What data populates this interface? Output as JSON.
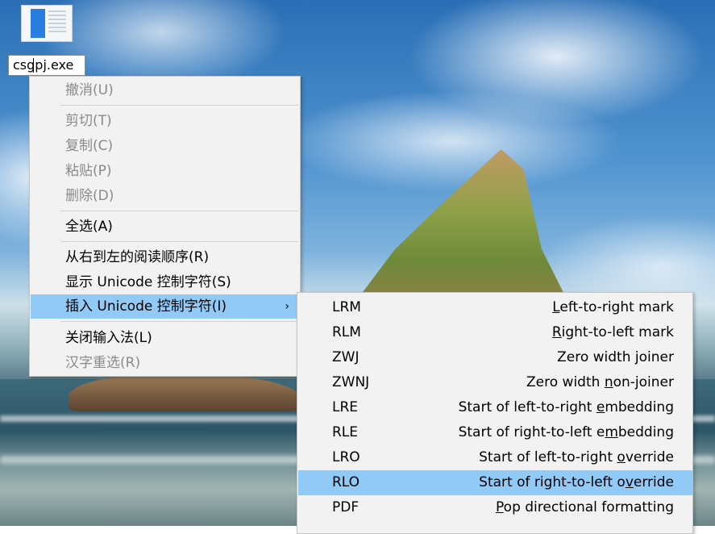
{
  "desktop": {
    "file_name": "csgpj.exe"
  },
  "context_menu": {
    "items": [
      {
        "label": "撤消(U)",
        "enabled": false
      },
      {
        "label": "剪切(T)",
        "enabled": false
      },
      {
        "label": "复制(C)",
        "enabled": false
      },
      {
        "label": "粘贴(P)",
        "enabled": false
      },
      {
        "label": "删除(D)",
        "enabled": false
      },
      {
        "label": "全选(A)",
        "enabled": true
      },
      {
        "label": "从右到左的阅读顺序(R)",
        "enabled": true
      },
      {
        "label": "显示 Unicode 控制字符(S)",
        "enabled": true
      },
      {
        "label": "插入 Unicode 控制字符(I)",
        "enabled": true,
        "highlighted": true,
        "submenu_arrow": "›"
      },
      {
        "label": "关闭输入法(L)",
        "enabled": true
      },
      {
        "label": "汉字重选(R)",
        "enabled": false
      }
    ]
  },
  "submenu": {
    "items": [
      {
        "code": "LRM",
        "pre": "",
        "key": "L",
        "post": "eft-to-right mark"
      },
      {
        "code": "RLM",
        "pre": "",
        "key": "R",
        "post": "ight-to-left mark"
      },
      {
        "code": "ZWJ",
        "pre": "Zero width ",
        "key": "j",
        "post": "oiner"
      },
      {
        "code": "ZWNJ",
        "pre": "Zero width ",
        "key": "n",
        "post": "on-joiner"
      },
      {
        "code": "LRE",
        "pre": "Start of left-to-right ",
        "key": "e",
        "post": "mbedding"
      },
      {
        "code": "RLE",
        "pre": "Start of right-to-left e",
        "key": "m",
        "post": "bedding"
      },
      {
        "code": "LRO",
        "pre": "Start of left-to-right ",
        "key": "o",
        "post": "verride"
      },
      {
        "code": "RLO",
        "pre": "Start of right-to-left o",
        "key": "v",
        "post": "erride",
        "highlighted": true
      },
      {
        "code": "PDF",
        "pre": "",
        "key": "P",
        "post": "op directional formatting"
      }
    ]
  },
  "colors": {
    "menu_bg": "#f2f2f2",
    "highlight": "#91c9f7",
    "disabled_text": "#8a8a8a"
  }
}
